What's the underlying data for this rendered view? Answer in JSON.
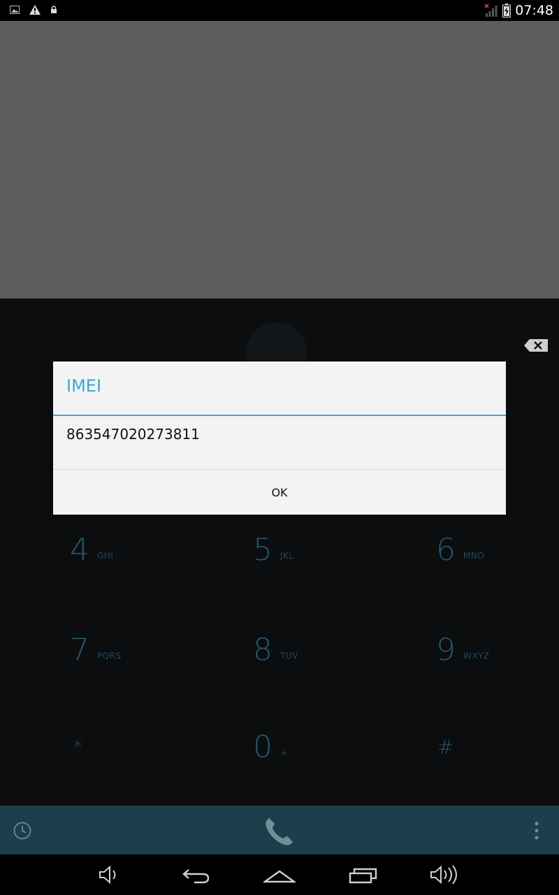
{
  "status_bar": {
    "time": "07:48",
    "left_icons": [
      "image-icon",
      "warning-icon",
      "lock-icon"
    ],
    "right_icons": [
      "no-signal-icon",
      "battery-charging-icon"
    ]
  },
  "dialpad": {
    "keys": [
      {
        "digit": "4",
        "letters": "GHI"
      },
      {
        "digit": "5",
        "letters": "JKL"
      },
      {
        "digit": "6",
        "letters": "MNO"
      },
      {
        "digit": "7",
        "letters": "PQRS"
      },
      {
        "digit": "8",
        "letters": "TUV"
      },
      {
        "digit": "9",
        "letters": "WXYZ"
      },
      {
        "digit": "*",
        "letters": ""
      },
      {
        "digit": "0",
        "letters": "+"
      },
      {
        "digit": "#",
        "letters": ""
      }
    ]
  },
  "dialog": {
    "title": "IMEI",
    "message": "863547020273811",
    "ok_label": "OK"
  },
  "colors": {
    "accent": "#3aa8cf",
    "dialog_bg": "#f3f3f3",
    "dialpad_bg": "#0b0d0f",
    "action_bar_bg": "#1d3e4b",
    "digit_color": "#27566e"
  }
}
